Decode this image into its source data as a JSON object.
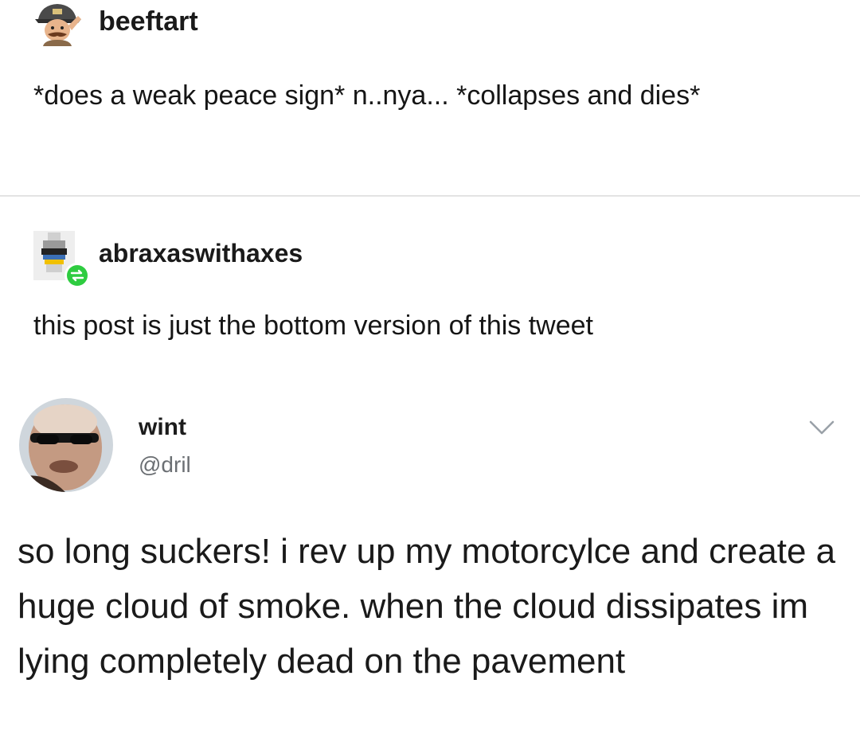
{
  "post1": {
    "username": "beeftart",
    "text": "*does a weak peace sign* n..nya... *collapses and dies*"
  },
  "post2": {
    "username": "abraxaswithaxes",
    "text": "this post is just the bottom version of this tweet",
    "reblog_badge_color": "#2ecc40"
  },
  "tweet": {
    "display_name": "wint",
    "handle": "@dril",
    "menu_icon": "chevron-down-icon",
    "text": "so long suckers! i rev up my motorcylce and create a huge cloud of smoke. when the cloud dissipates im lying completely dead on the pavement"
  }
}
